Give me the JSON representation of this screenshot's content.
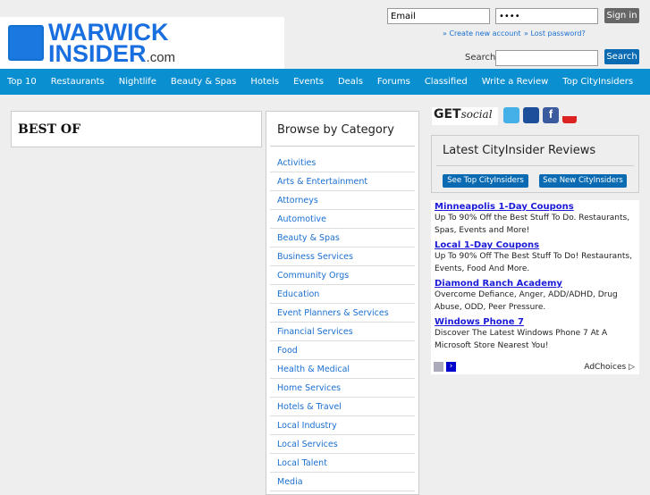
{
  "logo": {
    "line1": "WARWICK",
    "line2": "INSIDER",
    "suffix": ".com"
  },
  "login": {
    "email_value": "Email",
    "password_value": "••••",
    "signin": "Sign in",
    "create": "» Create new account",
    "lost": "» Lost password?"
  },
  "search": {
    "label": "Search",
    "button": "Search",
    "value": ""
  },
  "nav": [
    "Top 10",
    "Restaurants",
    "Nightlife",
    "Beauty & Spas",
    "Hotels",
    "Events",
    "Deals",
    "Forums",
    "Classified",
    "Write a Review",
    "Top CityInsiders"
  ],
  "best_of": "BEST OF",
  "browse": {
    "title": "Browse by Category",
    "items": [
      "Activities",
      "Arts & Entertainment",
      "Attorneys",
      "Automotive",
      "Beauty & Spas",
      "Business Services",
      "Community Orgs",
      "Education",
      "Event Planners & Services",
      "Financial Services",
      "Food",
      "Health & Medical",
      "Home Services",
      "Hotels & Travel",
      "Local Industry",
      "Local Services",
      "Local Talent",
      "Media"
    ]
  },
  "social": {
    "get": "GET",
    "social": "social",
    "icons": [
      "twitter-icon",
      "myspace-icon",
      "facebook-icon",
      "youtube-icon"
    ]
  },
  "reviews": {
    "title": "Latest CityInsider Reviews",
    "btn_top": "See Top CityInsiders",
    "btn_new": "See New CityInsiders"
  },
  "ads": [
    {
      "title": "Minneapolis 1-Day Coupons",
      "text": "Up To 90% Off the Best Stuff To Do. Restaurants, Spas, Events and More!"
    },
    {
      "title": "Local 1-Day Coupons",
      "text": "Up To 90% Off The Best Stuff To Do! Restaurants, Events, Food And More."
    },
    {
      "title": "Diamond Ranch Academy",
      "text": "Overcome Defiance, Anger, ADD/ADHD, Drug Abuse, ODD, Peer Pressure."
    },
    {
      "title": "Windows Phone 7",
      "text": "Discover The Latest Windows Phone 7 At A Microsoft Store Nearest You!"
    }
  ],
  "adchoices": "AdChoices ▷"
}
